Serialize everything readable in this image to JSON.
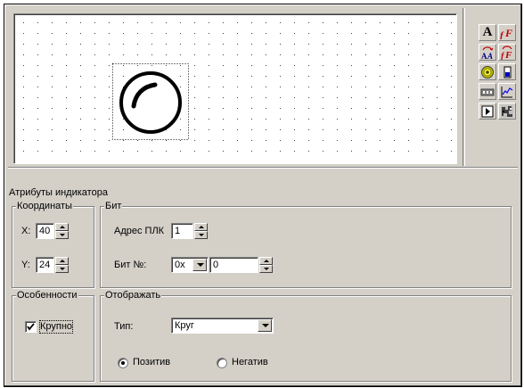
{
  "toolbox": {
    "tools": [
      {
        "name": "text-tool-icon",
        "glyph": "A"
      },
      {
        "name": "font-tool-icon",
        "glyph": "fF"
      },
      {
        "name": "text-swap-tool-icon",
        "glyph": "AA"
      },
      {
        "name": "font-swap-tool-icon",
        "glyph": "fF"
      },
      {
        "name": "lamp-indicator-tool-icon",
        "glyph": "◎"
      },
      {
        "name": "gauge-tool-icon",
        "glyph": "▮"
      },
      {
        "name": "numeric-display-tool-icon",
        "glyph": "▭"
      },
      {
        "name": "trend-chart-tool-icon",
        "glyph": "〰"
      },
      {
        "name": "button-tool-icon",
        "glyph": "▸"
      },
      {
        "name": "bitmap-tool-icon",
        "glyph": "▦"
      }
    ]
  },
  "attributes": {
    "title": "Атрибуты индикатора",
    "coords": {
      "title": "Координаты",
      "x_label": "X:",
      "x_value": "40",
      "y_label": "Y:",
      "y_value": "24"
    },
    "bit": {
      "title": "Бит",
      "plc_address_label": "Адрес ПЛК",
      "plc_address_value": "1",
      "bit_no_label": "Бит №:",
      "bit_prefix_value": "0x",
      "bit_value": "0"
    },
    "features": {
      "title": "Особенности",
      "large_label": "Крупно",
      "large_checked": true
    },
    "display": {
      "title": "Отображать",
      "type_label": "Тип:",
      "type_value": "Круг",
      "positive_label": "Позитив",
      "negative_label": "Негатив",
      "selected": "positive"
    }
  }
}
